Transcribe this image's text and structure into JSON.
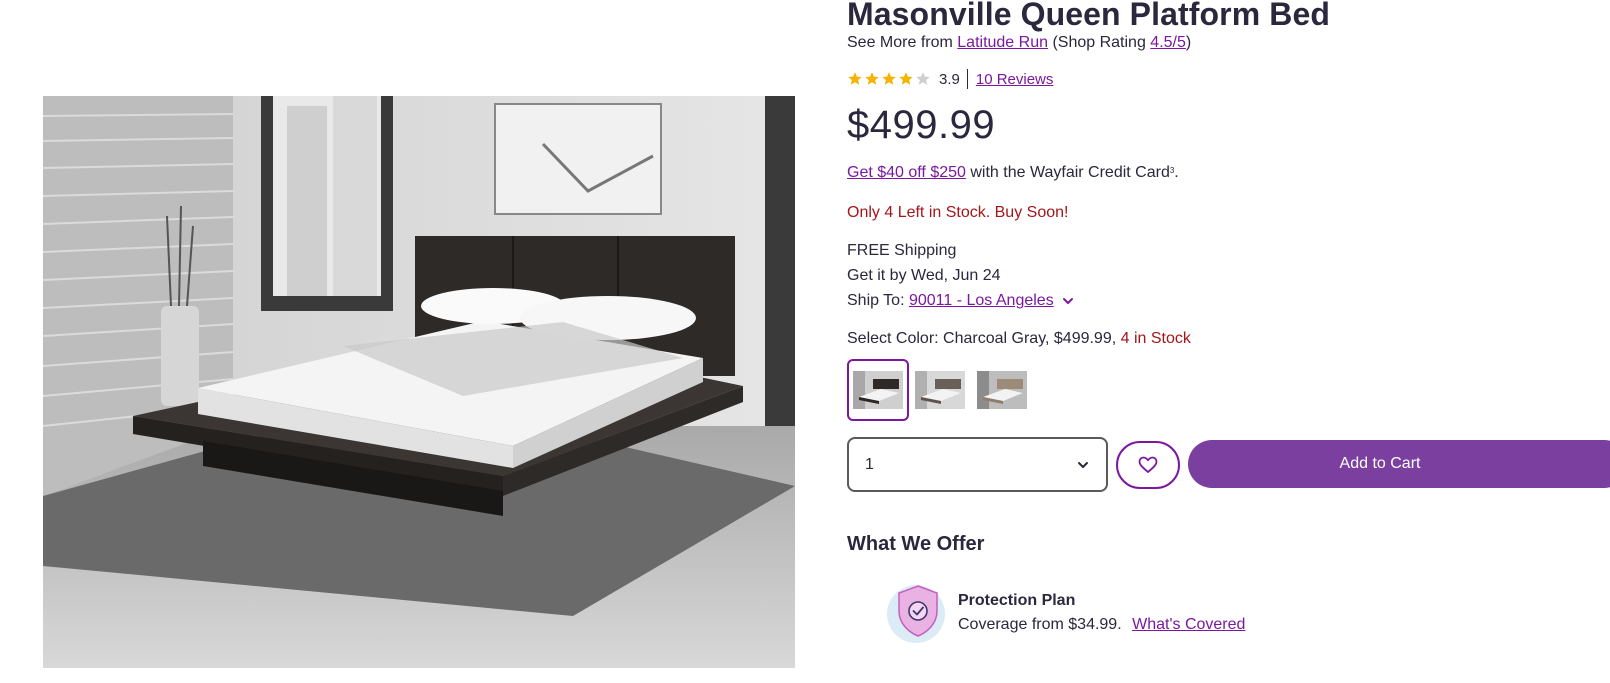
{
  "product": {
    "title": "Masonville Queen Platform Bed",
    "see_more_prefix": "See More from",
    "brand": "Latitude Run",
    "shop_rating_prefix": "(Shop Rating",
    "shop_rating": "4.5/5",
    "shop_rating_suffix": ")",
    "rating": "3.9",
    "rating_value": 3.9,
    "reviews_link": "10 Reviews",
    "price": "$499.99"
  },
  "credit": {
    "link": "Get $40 off $250",
    "text": "with the Wayfair Credit Card",
    "footnote": "3",
    "suffix": "."
  },
  "stock_message": "Only 4 Left in Stock. Buy Soon!",
  "shipping": {
    "free": "FREE Shipping",
    "eta": "Get it by Wed, Jun 24",
    "ship_to_label": "Ship To:",
    "ship_to_value": "90011 - Los Angeles"
  },
  "color": {
    "label": "Select Color: Charcoal Gray, $499.99,",
    "stock": "4 in Stock",
    "selected_index": 0,
    "swatch_count": 3
  },
  "quantity": {
    "value": "1"
  },
  "actions": {
    "add_to_cart": "Add to Cart"
  },
  "offer": {
    "heading": "What We Offer",
    "plan_title": "Protection Plan",
    "plan_desc": "Coverage from $34.99.",
    "plan_link": "What's Covered"
  },
  "icons": {
    "stars": "star-icon",
    "ship_chevron": "chevron-down-icon",
    "qty_chevron": "chevron-down-icon",
    "favorite": "heart-icon",
    "protection": "shield-check-icon"
  },
  "colors": {
    "accent": "#7b189f",
    "button": "#7b3fa0",
    "alert": "#a4161a",
    "star": "#f5b400",
    "star_empty": "#cfcfcf"
  }
}
